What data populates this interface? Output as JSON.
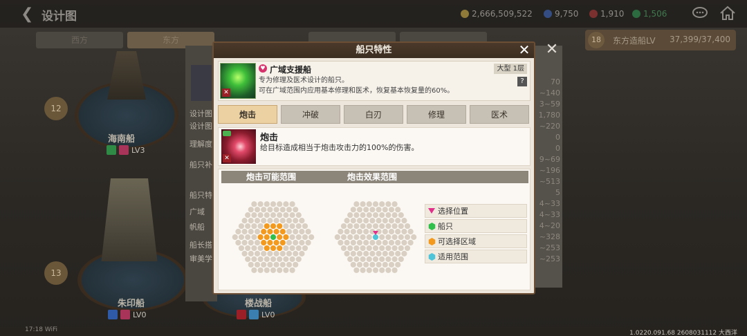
{
  "header": {
    "title": "设计图",
    "resources": [
      "2,666,509,522",
      "9,750",
      "1,910",
      "1,506"
    ],
    "colors": {
      "gold": "#c8a640",
      "blue": "#3a5fb0",
      "red": "#b83a3a",
      "green": "#2f9e55"
    }
  },
  "bg_tabs": [
    "西方",
    "东方"
  ],
  "level_badge": {
    "level": "18",
    "label": "东方造船LV",
    "value": "37,399/37,400"
  },
  "ships": [
    {
      "name": "海南船",
      "level_badge": "12",
      "lv": "LV3"
    },
    {
      "name": "朱印船",
      "level_badge": "13",
      "lv": "LV0"
    },
    {
      "name": "楼战船",
      "lv": "LV0"
    }
  ],
  "side_labels": [
    "设计图",
    "设计图",
    "理解度",
    "船只补",
    "船只特",
    "广域",
    "帆船",
    "船长搭",
    "审美学"
  ],
  "right_values": [
    "70",
    "~140",
    "3~59",
    "1,780",
    "~220",
    "0",
    "0",
    "9~69",
    "~196",
    "~513",
    "5",
    "4~33",
    "4~33",
    "4~20",
    "~328",
    "~253",
    "~253"
  ],
  "modal": {
    "title": "船只特性",
    "close": "✕",
    "ship": {
      "name": "广域支援船",
      "size": "大型 1层",
      "desc1": "专为修理及医术设计的船只。",
      "desc2": "可在广域范围内应用基本修理和医术，恢复基本恢复量的60%。"
    },
    "tabs": [
      "炮击",
      "冲破",
      "白刃",
      "修理",
      "医术"
    ],
    "active_tab": 0,
    "skill": {
      "name": "炮击",
      "desc": "给目标造成相当于炮击攻击力的100%的伤害。"
    },
    "range": {
      "possible_label": "炮击可能范围",
      "effect_label": "炮击效果范围"
    },
    "legend": [
      {
        "label": "选择位置",
        "icon": "pink-triangle-icon",
        "color": "#e0308a"
      },
      {
        "label": "船只",
        "icon": "green-hex-icon",
        "color": "#2fbf4a"
      },
      {
        "label": "可选择区域",
        "icon": "orange-hex-icon",
        "color": "#f39a1e"
      },
      {
        "label": "适用范围",
        "icon": "cyan-hex-icon",
        "color": "#4fc4d8"
      }
    ]
  },
  "status_bar": {
    "time": "17:18",
    "wifi": "WiFi"
  },
  "version": "1.0220.091.68 2608031112 大西洋"
}
